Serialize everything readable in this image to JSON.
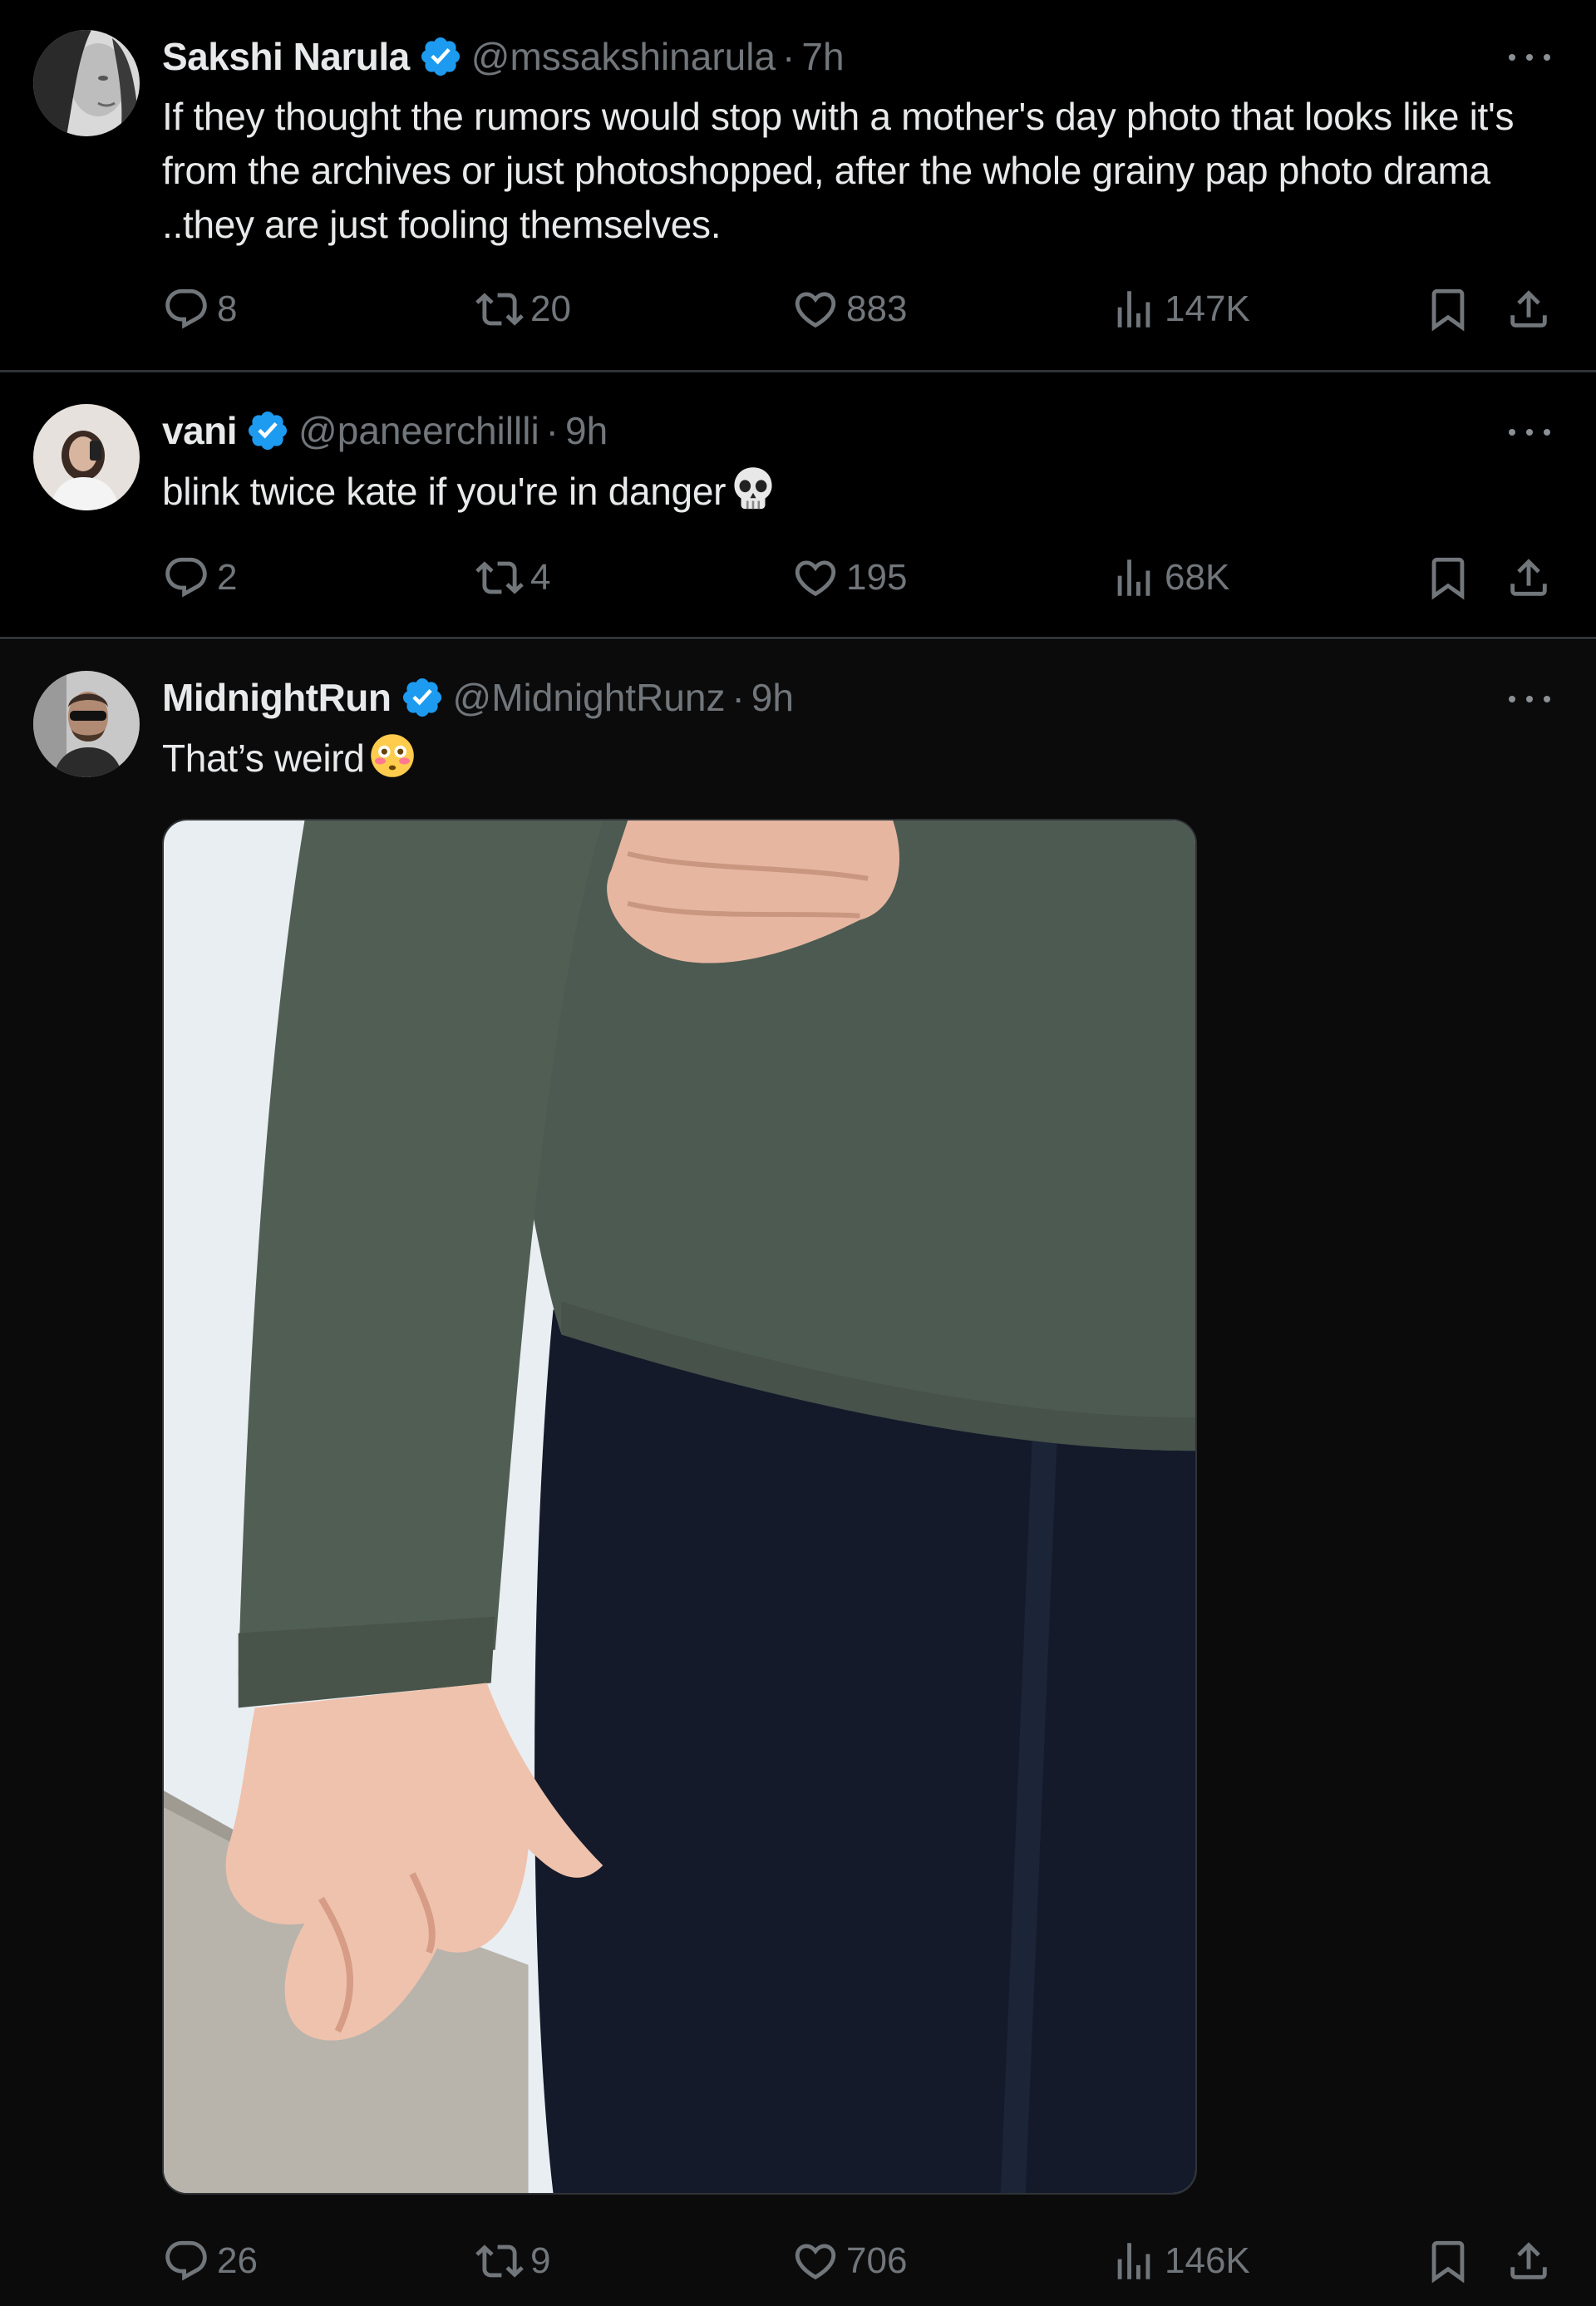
{
  "tweets": [
    {
      "name": "Sakshi Narula",
      "handle": "@mssakshinarula",
      "separator": "·",
      "time": "7h",
      "text": "If they thought the rumors would stop with a mother's day photo that looks like it's from the archives or just photoshopped, after the whole grainy pap photo drama ..they are just fooling themselves.",
      "replies": "8",
      "reposts": "20",
      "likes": "883",
      "views": "147K"
    },
    {
      "name": "vani",
      "handle": "@paneerchillli",
      "separator": "·",
      "time": "9h",
      "text": "blink twice kate if you're in danger",
      "emoji": "skull-emoji",
      "replies": "2",
      "reposts": "4",
      "likes": "195",
      "views": "68K"
    },
    {
      "name": "MidnightRun",
      "handle": "@MidnightRunz",
      "separator": "·",
      "time": "9h",
      "text": "That’s weird",
      "emoji": "flushed-face-emoji",
      "media": "photo-sweater-hand",
      "replies": "26",
      "reposts": "9",
      "likes": "706",
      "views": "146K"
    }
  ],
  "colors": {
    "background": "#000000",
    "text": "#e7e9ea",
    "secondary": "#71767b",
    "verified": "#1d9bf0",
    "divider": "#2f3336"
  }
}
